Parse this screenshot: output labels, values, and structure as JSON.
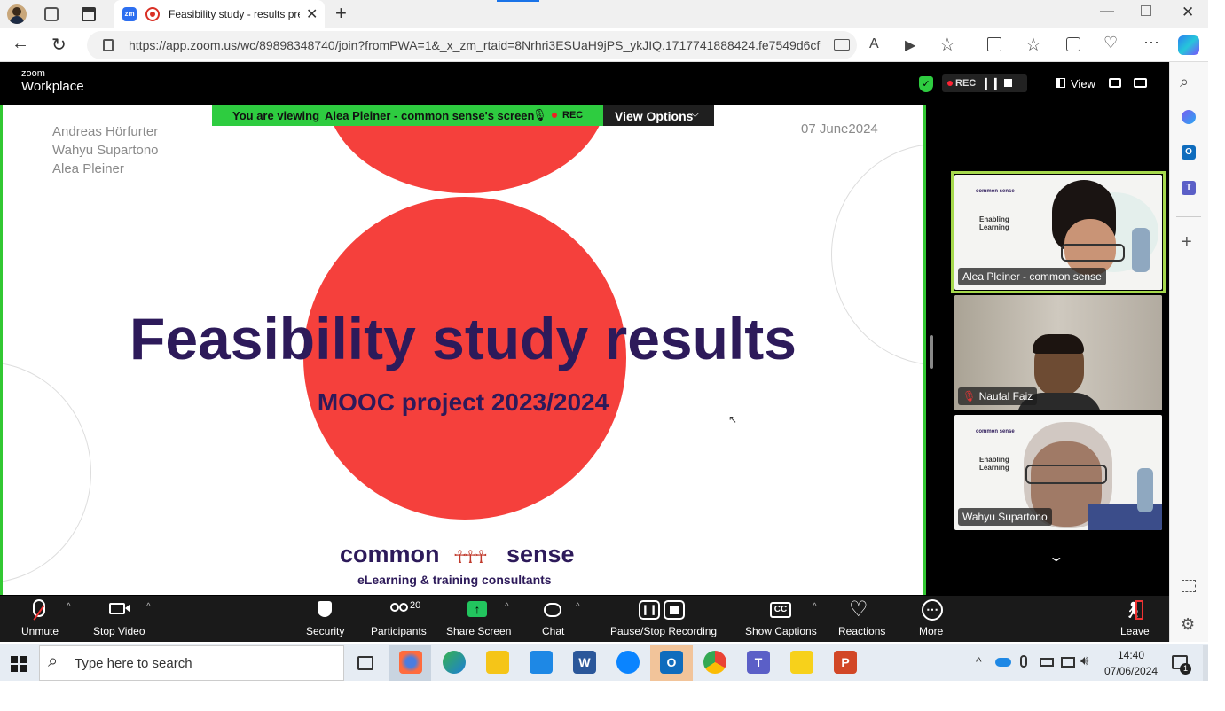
{
  "browser": {
    "tab_title": "Feasibility study - results pre",
    "url": "https://app.zoom.us/wc/89898348740/join?fromPWA=1&_x_zm_rtaid=8Nrhri3ESUaH9jPS_ykJIQ.1717741888424.fe7549d6cf6..."
  },
  "zoom": {
    "logo_top": "zoom",
    "logo_bottom": "Workplace",
    "rec_label": "REC",
    "view_label": "View",
    "viewing_banner": {
      "prefix": "You are viewing",
      "name": "Alea Pleiner - common sense's screen",
      "rec": "REC",
      "view_options": "View Options"
    }
  },
  "slide": {
    "authors": [
      "Andreas Hörfurter",
      "Wahyu Supartono",
      "Alea Pleiner"
    ],
    "date": "07 June2024",
    "title": "Feasibility study results",
    "subtitle": "MOOC project 2023/2024",
    "logo_left": "common",
    "logo_right": "sense",
    "logo_tagline": "eLearning & training consultants",
    "colors": {
      "circle": "#f5403c",
      "title": "#2d1a5a"
    }
  },
  "participants": [
    {
      "name": "Alea Pleiner - common sense",
      "active": true,
      "muted": false
    },
    {
      "name": "Naufal Faiz",
      "active": false,
      "muted": true
    },
    {
      "name": "Wahyu Supartono",
      "active": false,
      "muted": false
    }
  ],
  "thumb_slide_text": {
    "title": "Enabling\nLearning",
    "brand": "common sense"
  },
  "toolbar": {
    "unmute": "Unmute",
    "stop_video": "Stop Video",
    "security": "Security",
    "participants": "Participants",
    "participants_count": "20",
    "share_screen": "Share Screen",
    "chat": "Chat",
    "pause_stop_recording": "Pause/Stop Recording",
    "show_captions": "Show Captions",
    "reactions": "Reactions",
    "more": "More",
    "leave": "Leave"
  },
  "taskbar": {
    "search_placeholder": "Type here to search",
    "time": "14:40",
    "date": "07/06/2024",
    "notification_count": "1"
  }
}
